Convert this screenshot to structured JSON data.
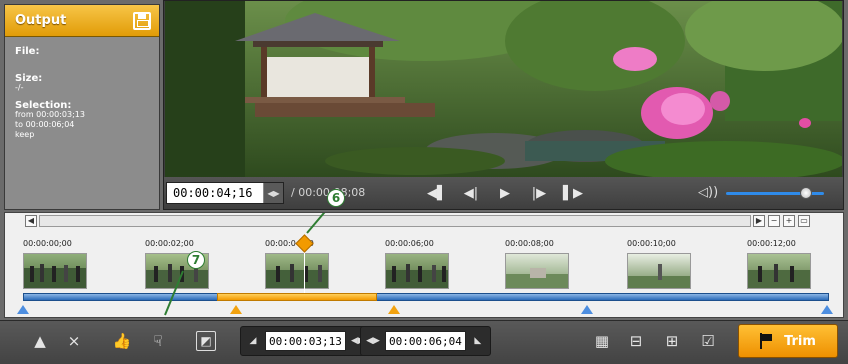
{
  "output": {
    "title": "Output",
    "file_label": "File:",
    "file_value": "",
    "size_label": "Size:",
    "size_value": "-/-",
    "selection_label": "Selection:",
    "selection_from": "from   00:00:03;13",
    "selection_to": "to       00:00:06;04",
    "selection_mode": "keep"
  },
  "player": {
    "current_time": "00:00:04;16",
    "duration": "/ 00:00:08;08"
  },
  "timeline": {
    "ticks": [
      "00:00:00;00",
      "00:00:02;00",
      "00:00:04;00",
      "00:00:06;00",
      "00:00:08;00",
      "00:00:10;00",
      "00:00:12;00"
    ],
    "callout_6": "6",
    "callout_7": "7"
  },
  "toolbar": {
    "start_time": "00:00:03;13",
    "end_time": "00:00:06;04",
    "trim_label": "Trim"
  },
  "colors": {
    "accent": "#f29a00",
    "track": "#2b6bb8"
  }
}
